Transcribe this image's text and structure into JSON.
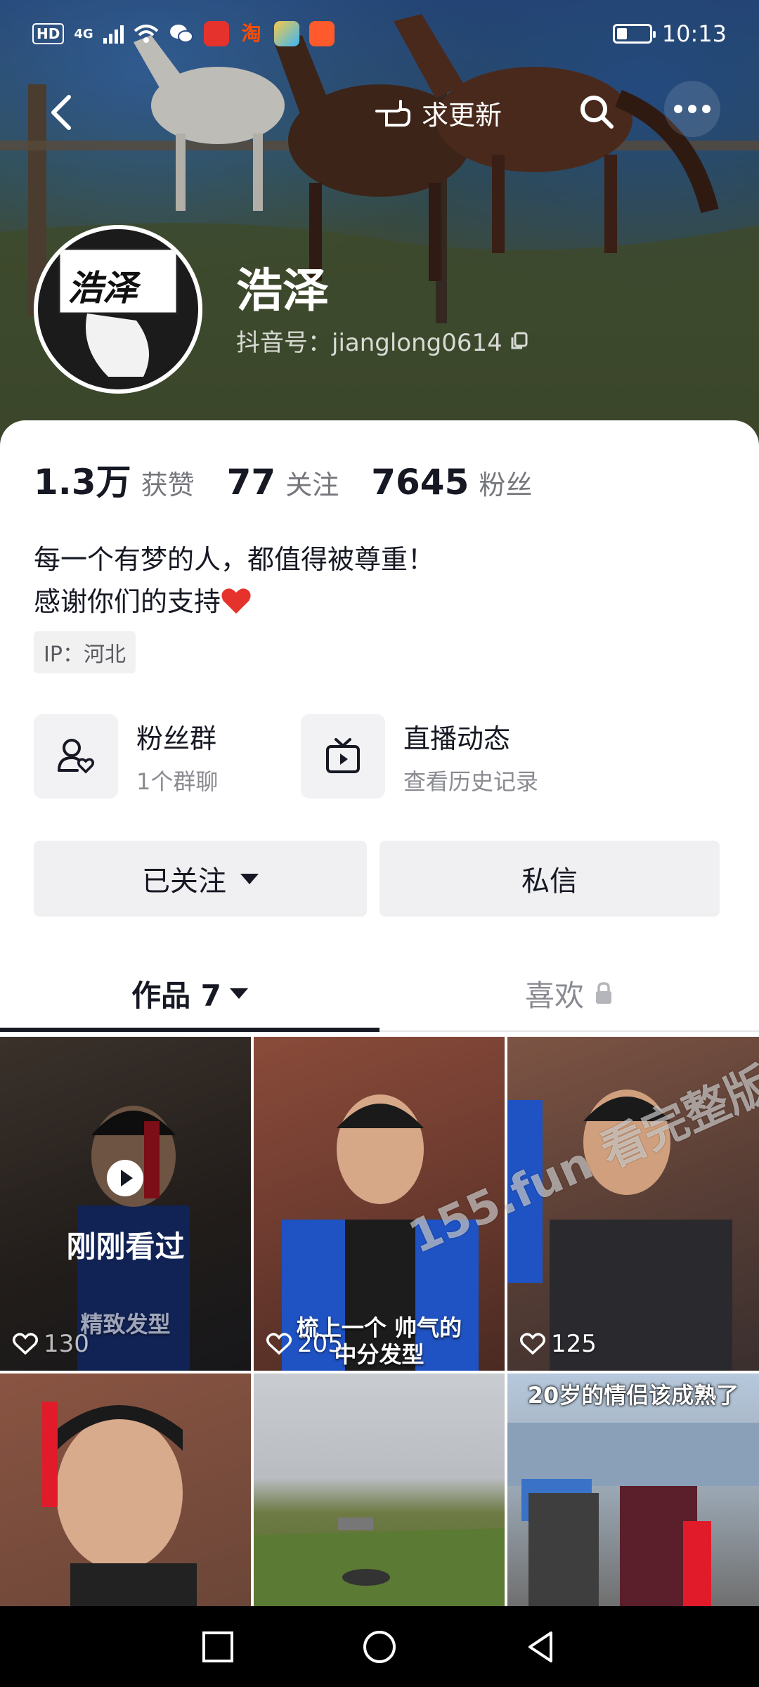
{
  "status_bar": {
    "network": "HD",
    "signal_type": "4G",
    "time": "10:13"
  },
  "nav": {
    "request_update_label": "求更新"
  },
  "profile": {
    "nickname": "浩泽",
    "douyin_id": "抖音号：jianglong0614",
    "avatar_text": "浩泽"
  },
  "stats": [
    {
      "value": "1.3万",
      "label": "获赞"
    },
    {
      "value": "77",
      "label": "关注"
    },
    {
      "value": "7645",
      "label": "粉丝"
    }
  ],
  "bio": {
    "line1": "每一个有梦的人，都值得被尊重！",
    "line2": "感谢你们的支持"
  },
  "ip": "IP：河北",
  "shortcuts": [
    {
      "title": "粉丝群",
      "subtitle": "1个群聊"
    },
    {
      "title": "直播动态",
      "subtitle": "查看历史记录"
    }
  ],
  "actions": {
    "following_label": "已关注",
    "message_label": "私信"
  },
  "tabs": {
    "works_label": "作品 7",
    "likes_label": "喜欢"
  },
  "videos": [
    {
      "likes": "130",
      "caption": "精致发型",
      "watched_label": "刚刚看过"
    },
    {
      "likes": "205",
      "caption": "梳上一个 帅气的中分发型"
    },
    {
      "likes": "125"
    },
    {},
    {},
    {
      "caption": "20岁的情侣该成熟了"
    }
  ],
  "watermark": "155.fun 看完整版",
  "colors": {
    "text_primary": "#161823",
    "text_secondary": "#76777d",
    "button_bg": "#f0f0f2",
    "heart_red": "#e5322d"
  }
}
